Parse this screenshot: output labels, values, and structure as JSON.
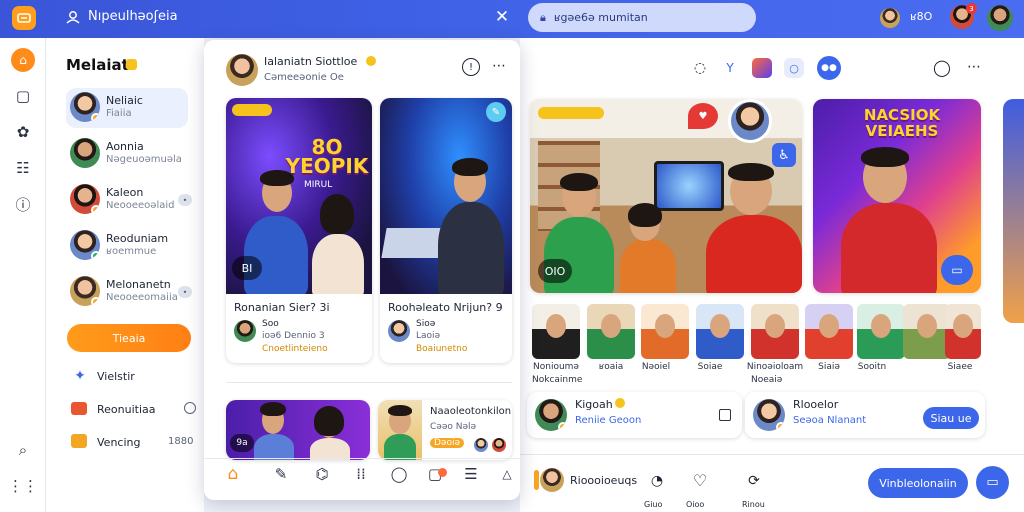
{
  "topbar": {
    "title": "Nıpeulhəoʃeia",
    "search_text": "ʁgəe6ə mumitan",
    "user_name": "ʁ8O ",
    "notif_count": "3"
  },
  "sidebar": {
    "heading": "Melaiat",
    "contacts": [
      {
        "name": "Neliaic",
        "sub": "Fiaiia"
      },
      {
        "name": "Aonnia",
        "sub": "Nəgeuoəmuəla"
      },
      {
        "name": "Kaleon",
        "sub": "Neooeeoəlaid"
      },
      {
        "name": "Reoduniam",
        "sub": "ʁoemmue"
      },
      {
        "name": "Melonanetn",
        "sub": "Neooeeomaiia"
      }
    ],
    "join_button": "Tieaia",
    "links": [
      {
        "label": "Vielstir",
        "count": ""
      },
      {
        "label": "Reonuitiaa",
        "count": ""
      },
      {
        "label": "Vencing",
        "count": "1880"
      }
    ]
  },
  "panel": {
    "host_name": "Ialaniatn Siottloe",
    "host_sub": "Cəmeeəonie Oe",
    "card1": {
      "title": "Ronanian Sier? 3i",
      "user": "Soo",
      "meta": "ioə6 Dennio 3",
      "tag": "Cnoetlinteieno",
      "overlay": "8O YEOPIK",
      "subtitle": "MIRUL",
      "counter": "BI"
    },
    "card2": {
      "title": "Roohəleato Nrijun? 9",
      "user": "Sioə",
      "meta": "Laoiə",
      "tag": "Boaiunetno",
      "counter": ""
    },
    "card3": {
      "counter": "9a"
    },
    "card4": {
      "title": "Naaoleotonkilon",
      "tag1": "Cəəo Nələ",
      "tag2": "Dəoiə"
    }
  },
  "main": {
    "video1": {
      "counter": "OIO"
    },
    "video3": {
      "headline": "NACSIOK VEIAEHS"
    },
    "reel_labels": [
      "Nonioumə",
      "ʁoaia",
      "Nəoiel",
      "Soiae",
      "Ninoəioloam",
      "Siaiə",
      "Sooitn",
      "Siaee"
    ],
    "reel_subs": [
      "Nokcainme",
      "",
      "",
      "",
      "Noeaiə",
      "",
      "",
      ""
    ],
    "post1": {
      "name": "Kigoah",
      "sub": "Reniie Geoon"
    },
    "post2": {
      "name": "Rlooelor",
      "sub": "Seəoa Nlanant",
      "button": "Siau ue"
    },
    "bottom_labels": [
      "Rioooioeuqs",
      "Giuo",
      "Oioo",
      "Rinou"
    ],
    "cta_button": "Vinbleolonaiin"
  },
  "colors": {
    "accent": "#3d67ea",
    "orange": "#ff8c1a",
    "topbar": "#3f62e6"
  }
}
